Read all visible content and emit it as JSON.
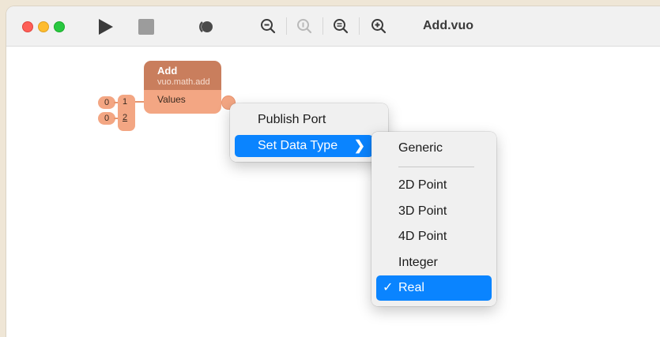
{
  "window": {
    "title": "Add.vuo"
  },
  "toolbar": {
    "icons": [
      "run-icon",
      "stop-icon",
      "stop-compositions-icon",
      "zoom-out-icon",
      "zoom-actual-icon",
      "zoom-to-fit-icon",
      "zoom-in-icon"
    ]
  },
  "node": {
    "title": "Add",
    "class_name": "vuo.math.add",
    "input_label": "Values",
    "list_items": [
      "1",
      "2"
    ],
    "constants": [
      "0",
      "0"
    ],
    "color_header": "#c97e5d",
    "color_body": "#f3a683"
  },
  "context_menu": {
    "items": [
      {
        "label": "Publish Port"
      },
      {
        "label": "Set Data Type",
        "submenu_indicator": "❯",
        "highlighted": true
      }
    ]
  },
  "submenu": {
    "items": [
      {
        "label": "Generic"
      },
      {
        "label": "2D Point"
      },
      {
        "label": "3D Point"
      },
      {
        "label": "4D Point"
      },
      {
        "label": "Integer"
      },
      {
        "label": "Real",
        "checked": true,
        "highlighted": true
      }
    ],
    "check_mark": "✓"
  },
  "colors": {
    "highlight": "#0a84ff"
  }
}
